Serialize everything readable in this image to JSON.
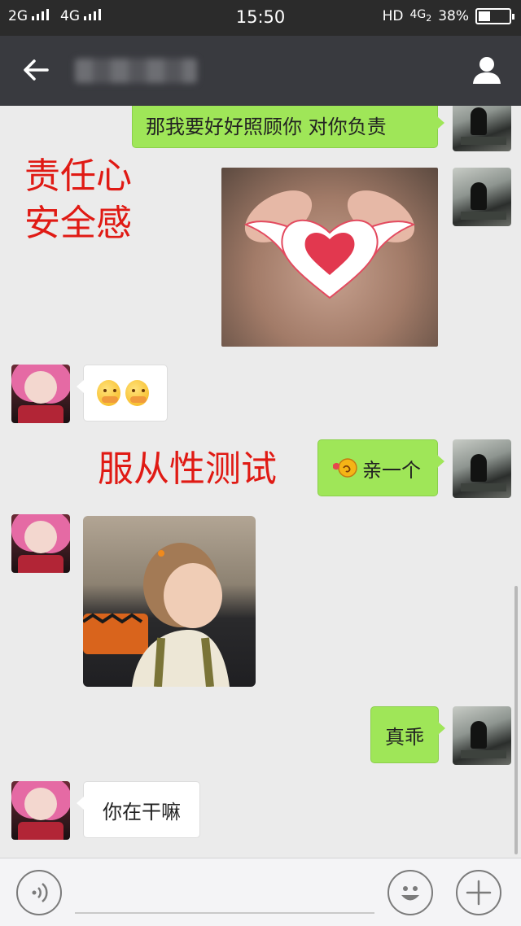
{
  "status_bar": {
    "network_1": "2G",
    "network_2": "4G",
    "time": "15:50",
    "hd": "HD",
    "network_3": "4G",
    "network_3_sub": "2",
    "battery": "38%",
    "battery_level": 0.38
  },
  "header": {
    "back_icon": "arrow-left-icon",
    "profile_icon": "person-icon"
  },
  "annotations": {
    "line1": "责任心",
    "line2": "安全感",
    "line3": "服从性测试"
  },
  "messages": [
    {
      "side": "self",
      "type": "text",
      "text": "那我要好好照顾你  对你负责"
    },
    {
      "side": "self",
      "type": "image",
      "description_icon": "heart-hands-photo"
    },
    {
      "side": "other",
      "type": "emoji",
      "emoji_icon": "shy-face-icon"
    },
    {
      "side": "self",
      "type": "text",
      "text": "亲一个",
      "prefix_icon": "kiss-emoji-icon"
    },
    {
      "side": "other",
      "type": "image",
      "description_icon": "toddler-photo"
    },
    {
      "side": "self",
      "type": "text",
      "text": "真乖"
    },
    {
      "side": "other",
      "type": "text",
      "text": "你在干嘛"
    }
  ],
  "input_bar": {
    "voice_icon": "voice-icon",
    "emoji_icon": "smiley-icon",
    "plus_icon": "plus-icon",
    "placeholder": ""
  },
  "colors": {
    "status_bar_bg": "#2b2b2b",
    "title_bar_bg": "#393a3f",
    "chat_bg": "#ebebeb",
    "self_bubble": "#9fe658",
    "other_bubble": "#ffffff",
    "annotation_red": "#e01a14"
  }
}
